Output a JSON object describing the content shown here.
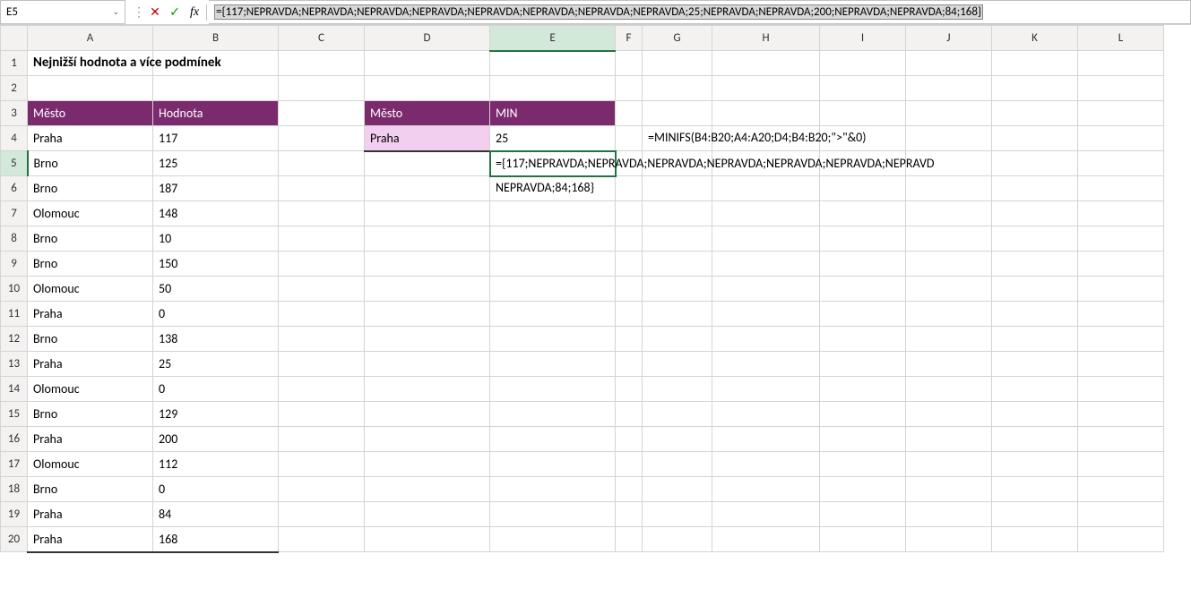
{
  "formula_bar": {
    "name_box": "E5",
    "formula": "={117;NEPRAVDA;NEPRAVDA;NEPRAVDA;NEPRAVDA;NEPRAVDA;NEPRAVDA;NEPRAVDA;NEPRAVDA;25;NEPRAVDA;NEPRAVDA;200;NEPRAVDA;NEPRAVDA;84;168}"
  },
  "columns": [
    "A",
    "B",
    "C",
    "D",
    "E",
    "F",
    "G",
    "H",
    "I",
    "J",
    "K",
    "L"
  ],
  "rows": [
    "1",
    "2",
    "3",
    "4",
    "5",
    "6",
    "7",
    "8",
    "9",
    "10",
    "11",
    "12",
    "13",
    "14",
    "15",
    "16",
    "17",
    "18",
    "19",
    "20"
  ],
  "title": "Nejnižší hodnota a více podmínek",
  "table1": {
    "header_city": "Město",
    "header_value": "Hodnota",
    "data": [
      {
        "city": "Praha",
        "value": "117"
      },
      {
        "city": "Brno",
        "value": "125"
      },
      {
        "city": "Brno",
        "value": "187"
      },
      {
        "city": "Olomouc",
        "value": "148"
      },
      {
        "city": "Brno",
        "value": "10"
      },
      {
        "city": "Brno",
        "value": "150"
      },
      {
        "city": "Olomouc",
        "value": "50"
      },
      {
        "city": "Praha",
        "value": "0"
      },
      {
        "city": "Brno",
        "value": "138"
      },
      {
        "city": "Praha",
        "value": "25"
      },
      {
        "city": "Olomouc",
        "value": "0"
      },
      {
        "city": "Brno",
        "value": "129"
      },
      {
        "city": "Praha",
        "value": "200"
      },
      {
        "city": "Olomouc",
        "value": "112"
      },
      {
        "city": "Brno",
        "value": "0"
      },
      {
        "city": "Praha",
        "value": "84"
      },
      {
        "city": "Praha",
        "value": "168"
      }
    ]
  },
  "table2": {
    "header_city": "Město",
    "header_min": "MIN",
    "row": {
      "city": "Praha",
      "min": "25"
    }
  },
  "formula_text_g4": "=MINIFS(B4:B20;A4:A20;D4;B4:B20;\">\"&0)",
  "editing_text_line1": "={117;NEPRAVDA;NEPRAVDA;NEPRAVDA;NEPRAVDA;NEPRAVDA;NEPRAVDA;NEPRAVD",
  "editing_text_line2": "NEPRAVDA;84;168}",
  "icons": {
    "dropdown": "⌄",
    "cancel": "✕",
    "check": "✓",
    "fx": "fx",
    "separator": "⋮"
  }
}
